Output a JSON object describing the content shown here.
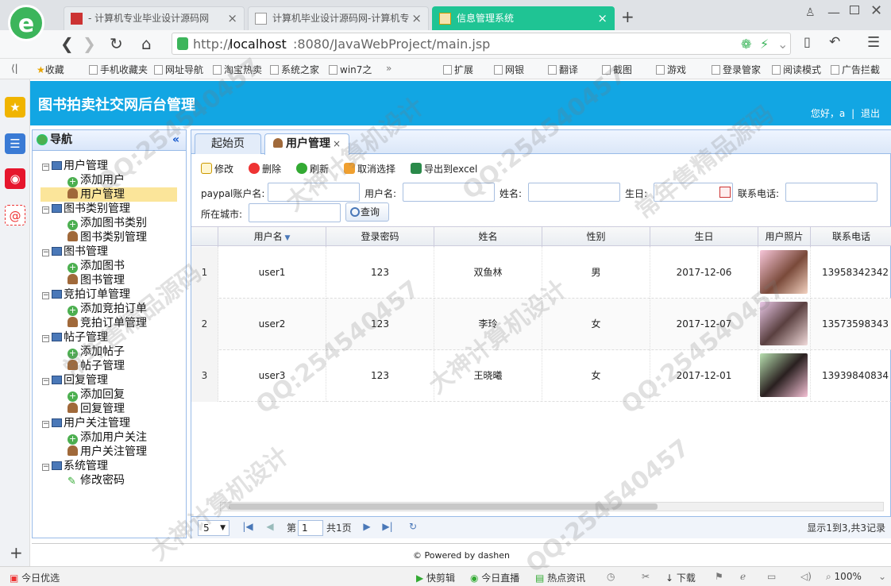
{
  "browser": {
    "logo": "e",
    "tabs": [
      {
        "title": "- 计算机专业毕业设计源码网"
      },
      {
        "title": "计算机毕业设计源码网-计算机专"
      },
      {
        "title": "信息管理系统"
      }
    ],
    "url_prefix": "http://",
    "url_host": "localhost",
    "url_rest": ":8080/JavaWebProject/main.jsp",
    "bookmarks": [
      "收藏",
      "手机收藏夹",
      "网址导航",
      "淘宝热卖",
      "系统之家",
      "win7之"
    ],
    "tools": [
      "扩展",
      "网银",
      "翻译",
      "截图",
      "游戏",
      "登录管家",
      "阅读模式",
      "广告拦截"
    ]
  },
  "app": {
    "title": "图书拍卖社交网后台管理",
    "greeting": "您好，a",
    "logout": "退出"
  },
  "nav": {
    "title": "导航",
    "collapse": "«",
    "items": [
      {
        "label": "用户管理",
        "kind": "group"
      },
      {
        "label": "添加用户",
        "kind": "add"
      },
      {
        "label": "用户管理",
        "kind": "person",
        "selected": true
      },
      {
        "label": "图书类别管理",
        "kind": "group"
      },
      {
        "label": "添加图书类别",
        "kind": "add"
      },
      {
        "label": "图书类别管理",
        "kind": "person"
      },
      {
        "label": "图书管理",
        "kind": "group"
      },
      {
        "label": "添加图书",
        "kind": "add"
      },
      {
        "label": "图书管理",
        "kind": "person"
      },
      {
        "label": "竞拍订单管理",
        "kind": "group"
      },
      {
        "label": "添加竞拍订单",
        "kind": "add"
      },
      {
        "label": "竞拍订单管理",
        "kind": "person"
      },
      {
        "label": "帖子管理",
        "kind": "group"
      },
      {
        "label": "添加帖子",
        "kind": "add"
      },
      {
        "label": "帖子管理",
        "kind": "person"
      },
      {
        "label": "回复管理",
        "kind": "group"
      },
      {
        "label": "添加回复",
        "kind": "add"
      },
      {
        "label": "回复管理",
        "kind": "person"
      },
      {
        "label": "用户关注管理",
        "kind": "group"
      },
      {
        "label": "添加用户关注",
        "kind": "add"
      },
      {
        "label": "用户关注管理",
        "kind": "person"
      },
      {
        "label": "系统管理",
        "kind": "group"
      },
      {
        "label": "修改密码",
        "kind": "pen"
      }
    ]
  },
  "main": {
    "tabs": [
      {
        "label": "起始页"
      },
      {
        "label": "用户管理",
        "close": "×"
      }
    ],
    "toolbar": {
      "edit": "修改",
      "delete": "删除",
      "refresh": "刷新",
      "cancel_select": "取消选择",
      "export": "导出到excel"
    },
    "filters": {
      "paypal": "paypal账户名:",
      "username": "用户名:",
      "name": "姓名:",
      "birthday": "生日:",
      "phone": "联系电话:",
      "city": "所在城市:",
      "query": "查询"
    },
    "columns": [
      "用户名",
      "登录密码",
      "姓名",
      "性别",
      "生日",
      "用户照片",
      "联系电话"
    ],
    "rows": [
      {
        "no": "1",
        "username": "user1",
        "password": "123",
        "name": "双鱼林",
        "gender": "男",
        "birthday": "2017-12-06",
        "phone": "13958342342"
      },
      {
        "no": "2",
        "username": "user2",
        "password": "123",
        "name": "李玲",
        "gender": "女",
        "birthday": "2017-12-07",
        "phone": "13573598343"
      },
      {
        "no": "3",
        "username": "user3",
        "password": "123",
        "name": "王晓曦",
        "gender": "女",
        "birthday": "2017-12-01",
        "phone": "13939840834"
      }
    ],
    "pager": {
      "page_size": "5",
      "page_label": "第",
      "page": "1",
      "total_pages": "共1页",
      "summary": "显示1到3,共3记录"
    }
  },
  "footer": {
    "text": "© Powered by dashen"
  },
  "status": {
    "left": "今日优选",
    "items": [
      "快剪辑",
      "今日直播",
      "热点资讯",
      "下载"
    ],
    "zoom": "100%"
  },
  "watermark": [
    "QQ:254540457",
    "大神计算机设计",
    "常年售精品源码"
  ],
  "colors": {
    "header": "#12a6e3",
    "active_tab": "#1fc494",
    "selected_nav": "#fbe59a",
    "panel_border": "#99bbe8"
  }
}
